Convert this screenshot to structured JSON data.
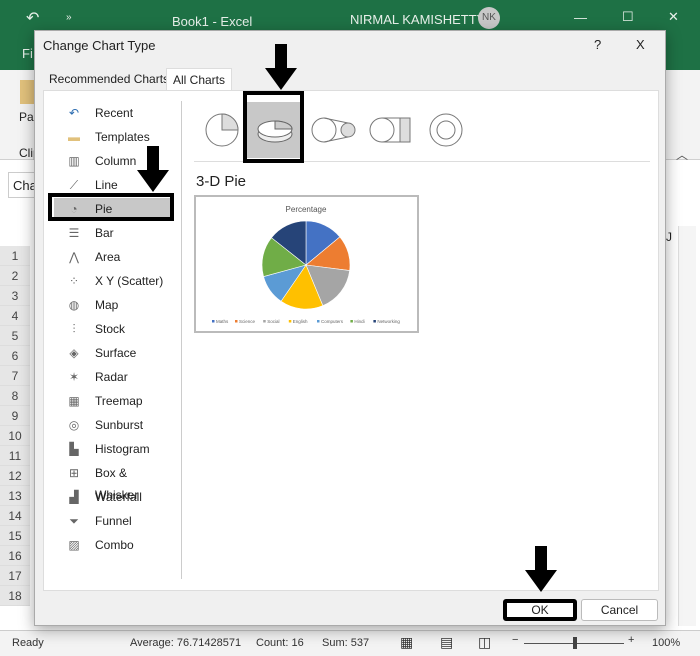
{
  "excel": {
    "title": "Book1 - Excel",
    "user": "NIRMAL KAMISHETTY",
    "initials": "NK",
    "file_tab": "Fi",
    "paste": "Pas",
    "clipboard": "Clip",
    "namebox": "Cha",
    "col_j": "J",
    "rows": [
      "1",
      "2",
      "3",
      "4",
      "5",
      "6",
      "7",
      "8",
      "9",
      "10",
      "11",
      "12",
      "13",
      "14",
      "15",
      "16",
      "17",
      "18"
    ]
  },
  "status": {
    "ready": "Ready",
    "average": "Average: 76.71428571",
    "count": "Count: 16",
    "sum": "Sum: 537",
    "zoom": "100%",
    "zoom_level": 100
  },
  "dialog": {
    "title": "Change Chart Type",
    "help": "?",
    "close": "X",
    "tabs": [
      {
        "label": "Recommended Charts"
      },
      {
        "label": "All Charts",
        "active": true
      }
    ],
    "chart_types": [
      {
        "label": "Recent",
        "icon": "recent-icon"
      },
      {
        "label": "Templates",
        "icon": "folder-icon"
      },
      {
        "label": "Column",
        "icon": "column-chart-icon"
      },
      {
        "label": "Line",
        "icon": "line-chart-icon"
      },
      {
        "label": "Pie",
        "icon": "pie-chart-icon",
        "selected": true
      },
      {
        "label": "Bar",
        "icon": "bar-chart-icon"
      },
      {
        "label": "Area",
        "icon": "area-chart-icon"
      },
      {
        "label": "X Y (Scatter)",
        "icon": "scatter-chart-icon"
      },
      {
        "label": "Map",
        "icon": "map-chart-icon"
      },
      {
        "label": "Stock",
        "icon": "stock-chart-icon"
      },
      {
        "label": "Surface",
        "icon": "surface-chart-icon"
      },
      {
        "label": "Radar",
        "icon": "radar-chart-icon"
      },
      {
        "label": "Treemap",
        "icon": "treemap-icon"
      },
      {
        "label": "Sunburst",
        "icon": "sunburst-icon"
      },
      {
        "label": "Histogram",
        "icon": "histogram-icon"
      },
      {
        "label": "Box & Whisker",
        "icon": "box-whisker-icon"
      },
      {
        "label": "Waterfall",
        "icon": "waterfall-icon"
      },
      {
        "label": "Funnel",
        "icon": "funnel-icon"
      },
      {
        "label": "Combo",
        "icon": "combo-chart-icon"
      }
    ],
    "subtypes": [
      "Pie",
      "3-D Pie",
      "Pie of Pie",
      "Bar of Pie",
      "Doughnut"
    ],
    "selected_subtype": "3-D Pie",
    "ok": "OK",
    "cancel": "Cancel"
  },
  "chart_data": {
    "type": "pie",
    "title": "Percentage",
    "legend": "bottom",
    "categories": [
      "Maths",
      "Science",
      "Social",
      "English",
      "Computers",
      "Hindi",
      "Networking"
    ],
    "values": [
      75,
      70,
      90,
      85,
      60,
      80,
      77
    ],
    "colors": [
      "#4472c4",
      "#ed7d31",
      "#a5a5a5",
      "#ffc000",
      "#5b9bd5",
      "#70ad47",
      "#264478"
    ]
  }
}
